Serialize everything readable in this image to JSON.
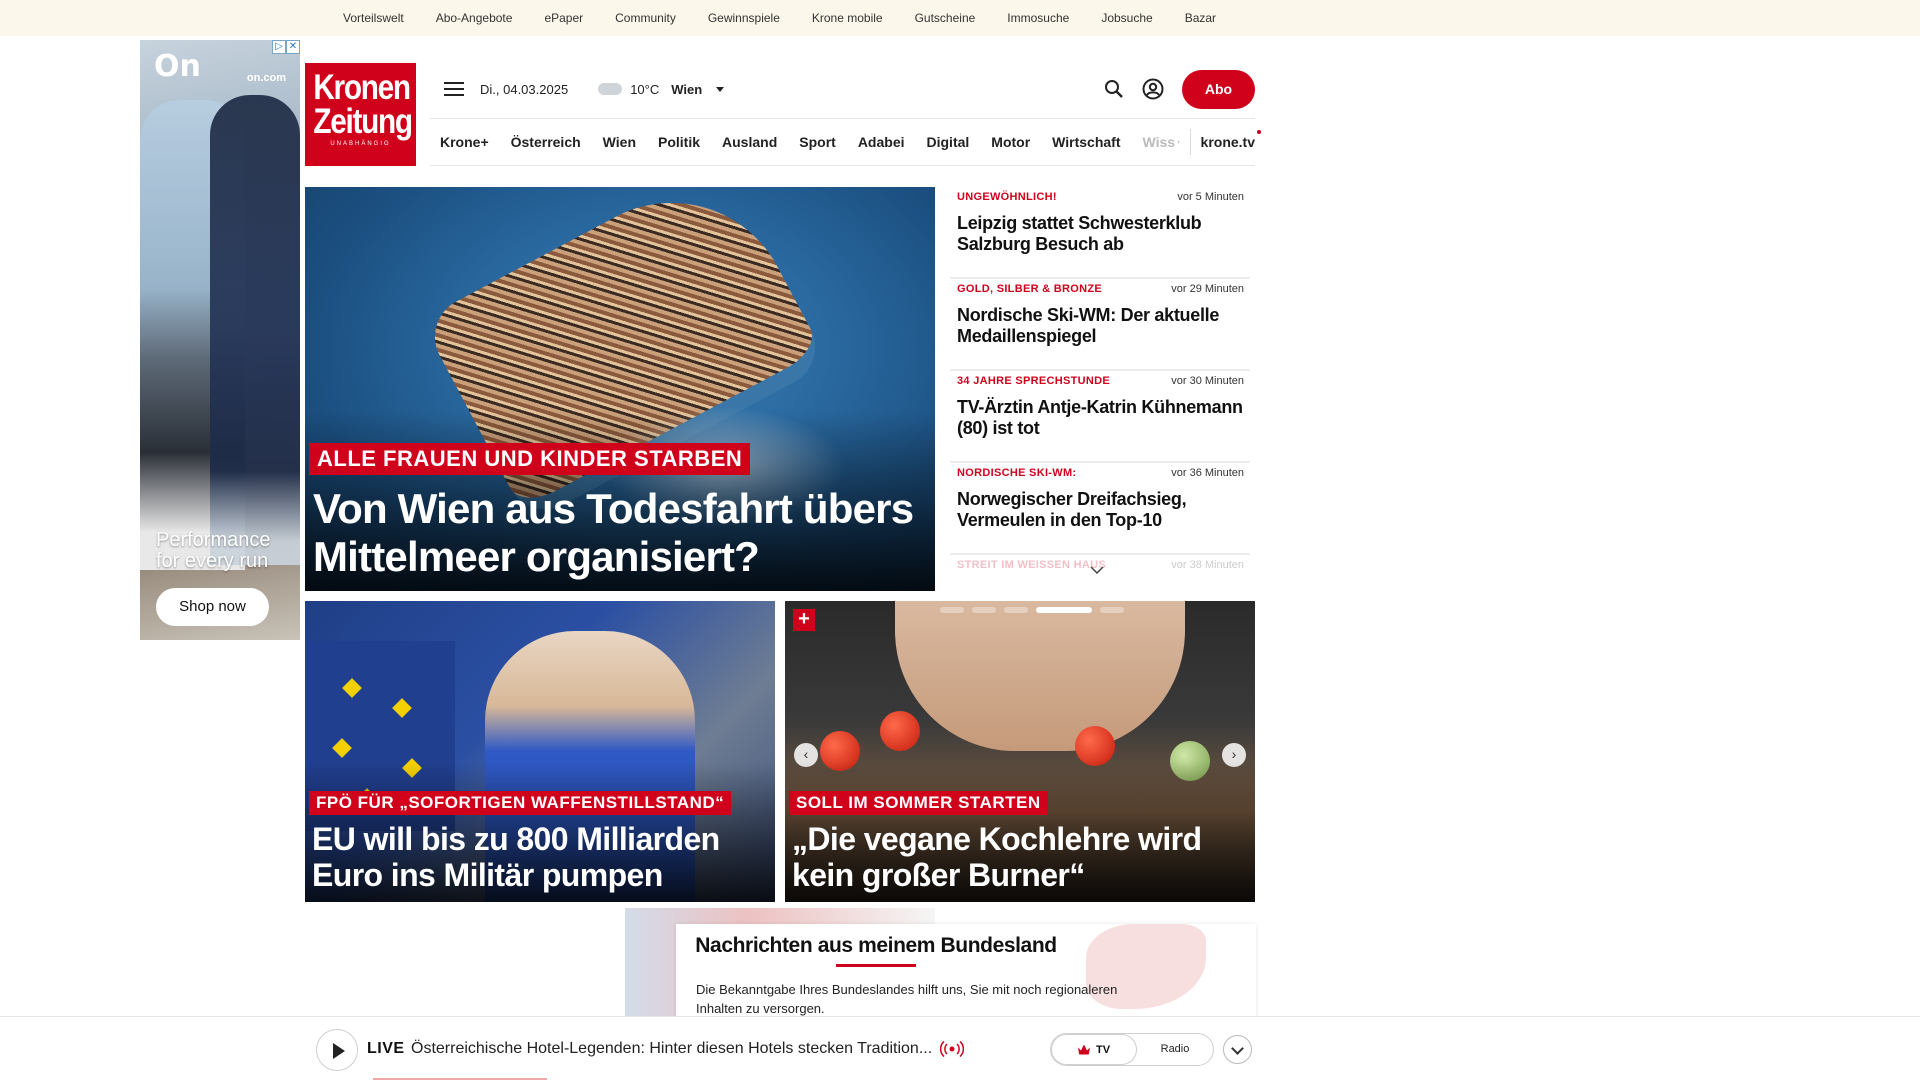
{
  "topbar": [
    "Vorteilswelt",
    "Abo-Angebote",
    "ePaper",
    "Community",
    "Gewinnspiele",
    "Krone mobile",
    "Gutscheine",
    "Immosuche",
    "Jobsuche",
    "Bazar"
  ],
  "ad": {
    "logo": "On",
    "brand": "on.com",
    "tagline_1": "Performance",
    "tagline_2": "for every run",
    "button": "Shop now"
  },
  "logo": {
    "line1": "Kronen",
    "line2": "Zeitung",
    "claim": "UNABHÄNGIG"
  },
  "header": {
    "date": "Di., 04.03.2025",
    "temperature": "10°C",
    "city": "Wien",
    "abo": "Abo",
    "icons": [
      "menu-icon",
      "weather-cloud-icon",
      "search-icon",
      "account-icon"
    ]
  },
  "nav": {
    "items": [
      "Krone+",
      "Österreich",
      "Wien",
      "Politik",
      "Ausland",
      "Sport",
      "Adabei",
      "Digital",
      "Motor",
      "Wirtschaft"
    ],
    "faded": "Wiss",
    "tv": "krone.tv"
  },
  "hero": {
    "kicker": "ALLE FRAUEN UND KINDER STARBEN",
    "title": "Von Wien aus Todesfahrt übers Mittelmeer organisiert?"
  },
  "ticker": [
    {
      "kicker": "UNGEWÖHNLICH!",
      "time": "vor 5 Minuten",
      "headline": "Leipzig stattet Schwesterklub Salzburg Besuch ab"
    },
    {
      "kicker": "GOLD, SILBER & BRONZE",
      "time": "vor 29 Minuten",
      "headline": "Nordische Ski-WM: Der aktuelle Medaillenspiegel"
    },
    {
      "kicker": "34 JAHRE SPRECHSTUNDE",
      "time": "vor 30 Minuten",
      "headline": "TV-Ärztin Antje-Katrin Kühnemann (80) ist tot"
    },
    {
      "kicker": "NORDISCHE SKI-WM:",
      "time": "vor 36 Minuten",
      "headline": "Norwegischer Dreifachsieg, Vermeulen in den Top-10"
    },
    {
      "kicker": "STREIT IM WEISSEN HAUS",
      "time": "vor 38 Minuten",
      "headline": ""
    }
  ],
  "teasers": [
    {
      "kicker": "FPÖ FÜR „SOFORTIGEN WAFFENSTILLSTAND“",
      "title": "EU will bis zu 800 Milliarden Euro ins Militär pumpen"
    },
    {
      "kicker": "SOLL IM SOMMER STARTEN",
      "title": "„Die vegane Kochlehre wird kein großer Burner“",
      "plus": "+",
      "prev": "‹",
      "next": "›"
    }
  ],
  "region": {
    "title": "Nachrichten aus meinem Bundesland",
    "text": "Die Bekanntgabe Ihres Bundeslandes hilft uns, Sie mit noch regionaleren Inhalten zu versorgen."
  },
  "live": {
    "label": "LIVE",
    "text": "Österreichische Hotel-Legenden: Hinter diesen Hotels stecken Tradition...",
    "tv": "TV",
    "radio": "Radio"
  }
}
